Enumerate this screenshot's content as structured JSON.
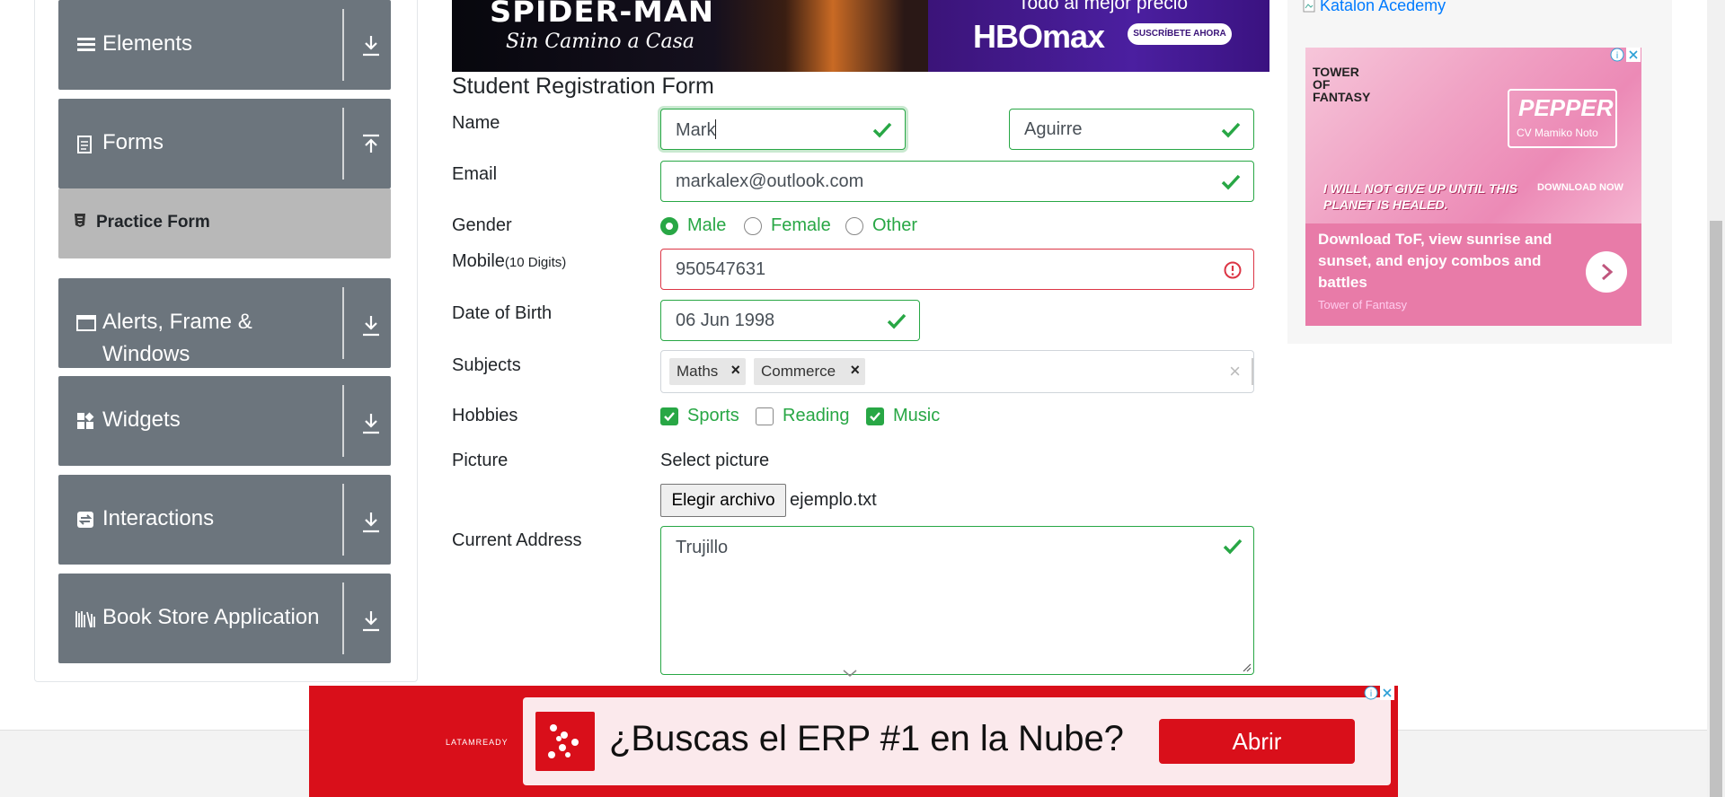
{
  "sidebar": {
    "groups": [
      {
        "label": "Elements",
        "icon": "hamburger-icon",
        "arrow": "download-icon"
      },
      {
        "label": "Forms",
        "icon": "document-icon",
        "arrow": "upload-icon"
      },
      {
        "label": "Alerts, Frame & Windows",
        "icon": "window-icon",
        "arrow": "download-icon"
      },
      {
        "label": "Widgets",
        "icon": "widgets-icon",
        "arrow": "download-icon"
      },
      {
        "label": "Interactions",
        "icon": "interactions-icon",
        "arrow": "download-icon"
      },
      {
        "label": "Book Store Application",
        "icon": "books-icon",
        "arrow": "download-icon"
      }
    ],
    "active_item": {
      "label": "Practice Form",
      "icon": "html5-icon"
    }
  },
  "top_ad": {
    "movie_title": "SPIDER-MAN",
    "movie_subtitle": "Sin Camino a Casa",
    "promo": "Todo al mejor precio",
    "brand": "HBOmax",
    "cta": "SUSCRÍBETE AHORA"
  },
  "form": {
    "title": "Student Registration Form",
    "labels": {
      "name": "Name",
      "email": "Email",
      "gender": "Gender",
      "mobile": "Mobile",
      "mobile_hint": "(10 Digits)",
      "dob": "Date of Birth",
      "subjects": "Subjects",
      "hobbies": "Hobbies",
      "picture": "Picture",
      "address": "Current Address"
    },
    "first_name": "Mark",
    "last_name": "Aguirre",
    "email": "markalex@outlook.com",
    "gender_options": [
      "Male",
      "Female",
      "Other"
    ],
    "gender_selected": "Male",
    "mobile": "950547631",
    "dob": "06 Jun 1998",
    "subjects": [
      "Maths",
      "Commerce"
    ],
    "hobbies": [
      {
        "label": "Sports",
        "checked": true
      },
      {
        "label": "Reading",
        "checked": false
      },
      {
        "label": "Music",
        "checked": true
      }
    ],
    "picture_label": "Select picture",
    "file_button": "Elegir archivo",
    "file_name": "ejemplo.txt",
    "address": "Trujillo",
    "colors": {
      "valid": "#28a745",
      "invalid": "#dc3545"
    }
  },
  "right_ad": {
    "broken_image_alt": "Katalon Acedemy",
    "game_logo": "TOWER OF FANTASY",
    "character": "PEPPER",
    "cv": "CV Mamiko Noto",
    "quote": "I WILL NOT GIVE UP UNTIL THIS PLANET IS HEALED.",
    "download": "DOWNLOAD NOW",
    "headline": "Download ToF, view sunrise and sunset, and enjoy combos and battles",
    "advertiser": "Tower of Fantasy"
  },
  "bottom_ad": {
    "logo": "LATAMREADY",
    "headline": "¿Buscas el ERP #1 en la Nube?",
    "cta": "Abrir"
  }
}
